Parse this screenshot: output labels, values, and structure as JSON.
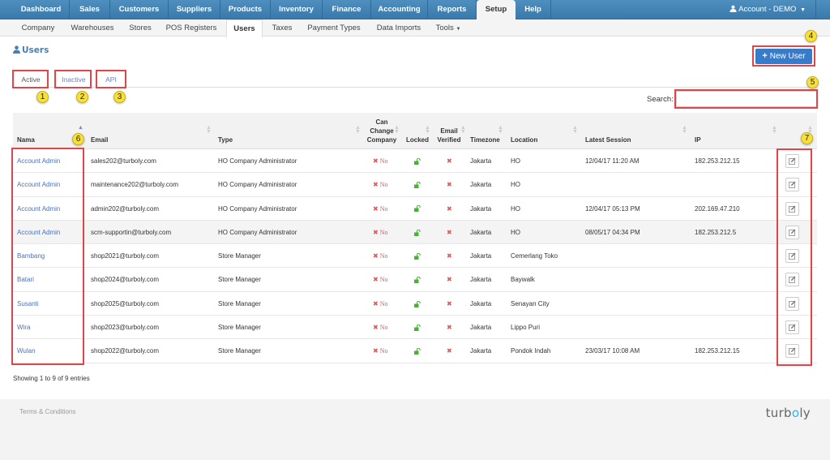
{
  "topnav": {
    "items": [
      {
        "label": "Dashboard",
        "active": false
      },
      {
        "label": "Sales",
        "active": false
      },
      {
        "label": "Customers",
        "active": false
      },
      {
        "label": "Suppliers",
        "active": false
      },
      {
        "label": "Products",
        "active": false
      },
      {
        "label": "Inventory",
        "active": false
      },
      {
        "label": "Finance",
        "active": false
      },
      {
        "label": "Accounting",
        "active": false
      },
      {
        "label": "Reports",
        "active": false
      },
      {
        "label": "Setup",
        "active": true
      },
      {
        "label": "Help",
        "active": false
      }
    ],
    "account_label": "Account - DEMO",
    "account_icon": "user-icon"
  },
  "subnav": {
    "items": [
      {
        "label": "Company"
      },
      {
        "label": "Warehouses"
      },
      {
        "label": "Stores"
      },
      {
        "label": "POS Registers"
      },
      {
        "label": "Users",
        "active": true
      },
      {
        "label": "Taxes"
      },
      {
        "label": "Payment Types"
      },
      {
        "label": "Data Imports"
      },
      {
        "label": "Tools"
      }
    ]
  },
  "page": {
    "title": "Users",
    "title_icon": "user-icon",
    "new_user_label": "New User",
    "new_user_icon": "plus-icon"
  },
  "tabs": [
    {
      "label": "Active",
      "active": true
    },
    {
      "label": "Inactive",
      "active": false
    },
    {
      "label": "API",
      "active": false
    }
  ],
  "search": {
    "label": "Search:",
    "value": "",
    "placeholder": ""
  },
  "table": {
    "columns": [
      "Nama",
      "Email",
      "Type",
      "Can Change Company",
      "Locked",
      "Email Verified",
      "Timezone",
      "Location",
      "Latest Session",
      "IP",
      ""
    ],
    "column_lines": {
      "can_change": [
        "Can",
        "Change",
        "Company"
      ],
      "email_verified": [
        "Email",
        "Verified"
      ]
    },
    "sorted_column": "Nama",
    "sort_direction": "asc",
    "rows": [
      {
        "name": "Account Admin",
        "email": "sales202@turboly.com",
        "type": "HO Company Administrator",
        "can_change": "No",
        "locked": "unlocked",
        "email_verified": "no",
        "timezone": "Jakarta",
        "location": "HO",
        "latest_session": "12/04/17 11:20 AM",
        "ip": "182.253.212.15"
      },
      {
        "name": "Account Admin",
        "email": "maintenance202@turboly.com",
        "type": "HO Company Administrator",
        "can_change": "No",
        "locked": "unlocked",
        "email_verified": "no",
        "timezone": "Jakarta",
        "location": "HO",
        "latest_session": "",
        "ip": ""
      },
      {
        "name": "Account Admin",
        "email": "admin202@turboly.com",
        "type": "HO Company Administrator",
        "can_change": "No",
        "locked": "unlocked",
        "email_verified": "no",
        "timezone": "Jakarta",
        "location": "HO",
        "latest_session": "12/04/17 05:13 PM",
        "ip": "202.169.47.210"
      },
      {
        "name": "Account Admin",
        "email": "scm-supportin@turboly.com",
        "type": "HO Company Administrator",
        "can_change": "No",
        "locked": "unlocked",
        "email_verified": "no",
        "timezone": "Jakarta",
        "location": "HO",
        "latest_session": "08/05/17 04:34 PM",
        "ip": "182.253.212.5",
        "highlighted": true
      },
      {
        "name": "Bambang",
        "email": "shop2021@turboly.com",
        "type": "Store Manager",
        "can_change": "No",
        "locked": "unlocked",
        "email_verified": "no",
        "timezone": "Jakarta",
        "location": "Cemerlang Toko",
        "latest_session": "",
        "ip": ""
      },
      {
        "name": "Batari",
        "email": "shop2024@turboly.com",
        "type": "Store Manager",
        "can_change": "No",
        "locked": "unlocked",
        "email_verified": "no",
        "timezone": "Jakarta",
        "location": "Baywalk",
        "latest_session": "",
        "ip": ""
      },
      {
        "name": "Susanti",
        "email": "shop2025@turboly.com",
        "type": "Store Manager",
        "can_change": "No",
        "locked": "unlocked",
        "email_verified": "no",
        "timezone": "Jakarta",
        "location": "Senayan City",
        "latest_session": "",
        "ip": ""
      },
      {
        "name": "Wira",
        "email": "shop2023@turboly.com",
        "type": "Store Manager",
        "can_change": "No",
        "locked": "unlocked",
        "email_verified": "no",
        "timezone": "Jakarta",
        "location": "Lippo Puri",
        "latest_session": "",
        "ip": ""
      },
      {
        "name": "Wulan",
        "email": "shop2022@turboly.com",
        "type": "Store Manager",
        "can_change": "No",
        "locked": "unlocked",
        "email_verified": "no",
        "timezone": "Jakarta",
        "location": "Pondok Indah",
        "latest_session": "23/03/17 10:08 AM",
        "ip": "182.253.212.15"
      }
    ],
    "showing": "Showing 1 to 9 of 9 entries"
  },
  "footer": {
    "terms_label": "Terms & Conditions",
    "brand": {
      "pre": "turb",
      "o": "o",
      "post": "ly"
    }
  },
  "annotations": [
    "1",
    "2",
    "3",
    "4",
    "5",
    "6",
    "7"
  ],
  "colors": {
    "nav_blue": "#3f82b4",
    "primary_button": "#3a7bc8",
    "link": "#4a72c0",
    "danger": "#e0575b",
    "success": "#4caf3a",
    "annotation_box": "#e0454a",
    "annotation_badge": "#f8e03a",
    "brand_accent": "#3ab0e8"
  }
}
